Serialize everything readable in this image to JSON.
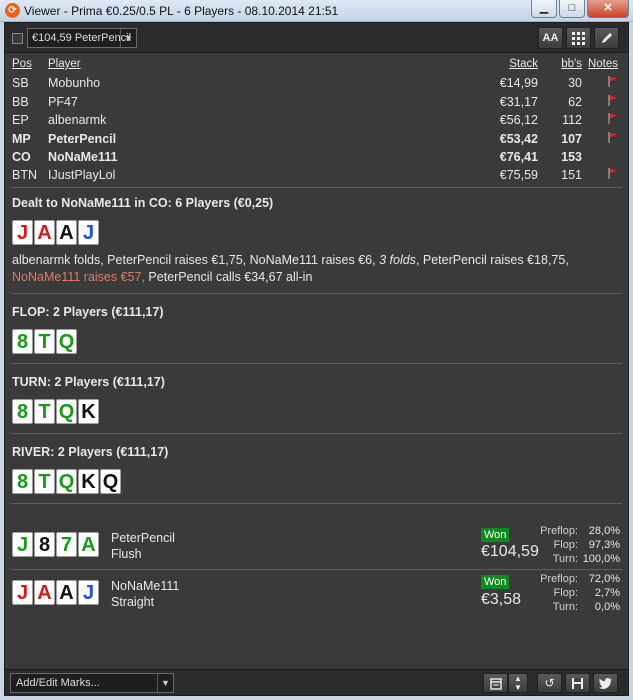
{
  "window": {
    "title": "Viewer - Prima €0.25/0.5 PL - 6 Players - 08.10.2014 21:51",
    "icon": "app-logo-icon",
    "buttons": [
      "minimize-icon",
      "maximize-icon",
      "close-icon"
    ]
  },
  "toolbar": {
    "hero_select": "€104,59 PeterPencil",
    "font_button": "AA",
    "icons": [
      "font-size-icon",
      "grid-icon",
      "edit-icon"
    ]
  },
  "players": {
    "headers": {
      "pos": "Pos",
      "player": "Player",
      "stack": "Stack",
      "bbs": "bb's",
      "notes": "Notes"
    },
    "rows": [
      {
        "pos": "SB",
        "player": "Mobunho",
        "stack": "€14,99",
        "bbs": "30",
        "flag": true,
        "bold": false
      },
      {
        "pos": "BB",
        "player": "PF47",
        "stack": "€31,17",
        "bbs": "62",
        "flag": true,
        "bold": false
      },
      {
        "pos": "EP",
        "player": "albenarmk",
        "stack": "€56,12",
        "bbs": "112",
        "flag": true,
        "bold": false
      },
      {
        "pos": "MP",
        "player": "PeterPencil",
        "stack": "€53,42",
        "bbs": "107",
        "flag": true,
        "bold": true
      },
      {
        "pos": "CO",
        "player": "NoNaMe111",
        "stack": "€76,41",
        "bbs": "153",
        "flag": false,
        "bold": true
      },
      {
        "pos": "BTN",
        "player": "IJustPlayLol",
        "stack": "€75,59",
        "bbs": "151",
        "flag": true,
        "bold": false
      }
    ],
    "flag_color": "#d9261c"
  },
  "preflop": {
    "title": "Dealt to NoNaMe111 in CO: 6 Players (€0,25)",
    "cards": [
      {
        "rank": "J",
        "suit": "h"
      },
      {
        "rank": "A",
        "suit": "h"
      },
      {
        "rank": "A",
        "suit": "s"
      },
      {
        "rank": "J",
        "suit": "d"
      }
    ],
    "actions_1": "albenarmk folds, PeterPencil raises €1,75, NoNaMe111 raises €6, ",
    "actions_folds": "3 folds",
    "actions_2": ", PeterPencil raises €18,75,",
    "actions_hero": "NoNaMe111 raises €57,",
    "actions_3": " PeterPencil calls €34,67 all-in"
  },
  "flop": {
    "title": "FLOP: 2 Players (€111,17)",
    "cards": [
      {
        "rank": "8",
        "suit": "c"
      },
      {
        "rank": "T",
        "suit": "c"
      },
      {
        "rank": "Q",
        "suit": "c"
      }
    ]
  },
  "turn": {
    "title": "TURN: 2 Players (€111,17)",
    "cards": [
      {
        "rank": "8",
        "suit": "c"
      },
      {
        "rank": "T",
        "suit": "c"
      },
      {
        "rank": "Q",
        "suit": "c"
      },
      {
        "rank": "K",
        "suit": "s"
      }
    ]
  },
  "river": {
    "title": "RIVER: 2 Players (€111,17)",
    "cards": [
      {
        "rank": "8",
        "suit": "c"
      },
      {
        "rank": "T",
        "suit": "c"
      },
      {
        "rank": "Q",
        "suit": "c"
      },
      {
        "rank": "K",
        "suit": "s"
      },
      {
        "rank": "Q",
        "suit": "s"
      }
    ]
  },
  "showdown": [
    {
      "player": "PeterPencil",
      "hand": "Flush",
      "cards": [
        {
          "rank": "J",
          "suit": "c"
        },
        {
          "rank": "8",
          "suit": "s"
        },
        {
          "rank": "7",
          "suit": "c"
        },
        {
          "rank": "A",
          "suit": "c"
        }
      ],
      "won_label": "Won",
      "amount": "€104,59",
      "equity": [
        {
          "label": "Preflop:",
          "value": "28,0%"
        },
        {
          "label": "Flop:",
          "value": "97,3%"
        },
        {
          "label": "Turn:",
          "value": "100,0%"
        }
      ]
    },
    {
      "player": "NoNaMe111",
      "hand": "Straight",
      "cards": [
        {
          "rank": "J",
          "suit": "h"
        },
        {
          "rank": "A",
          "suit": "h"
        },
        {
          "rank": "A",
          "suit": "s"
        },
        {
          "rank": "J",
          "suit": "d"
        }
      ],
      "won_label": "Won",
      "amount": "€3,58",
      "equity": [
        {
          "label": "Preflop:",
          "value": "72,0%"
        },
        {
          "label": "Flop:",
          "value": "2,7%"
        },
        {
          "label": "Turn:",
          "value": "0,0%"
        }
      ]
    }
  ],
  "bottom": {
    "marks_label": "Add/Edit Marks...",
    "icons": [
      "calendar-icon",
      "spinner-arrows-icon",
      "refresh-icon",
      "save-icon",
      "twitter-icon"
    ]
  },
  "colors": {
    "won_badge": "#0e8a1f",
    "hearts": "#d11b1b",
    "clubs": "#1a9a1a",
    "diamonds": "#1c4fd6",
    "spades": "#111111"
  }
}
